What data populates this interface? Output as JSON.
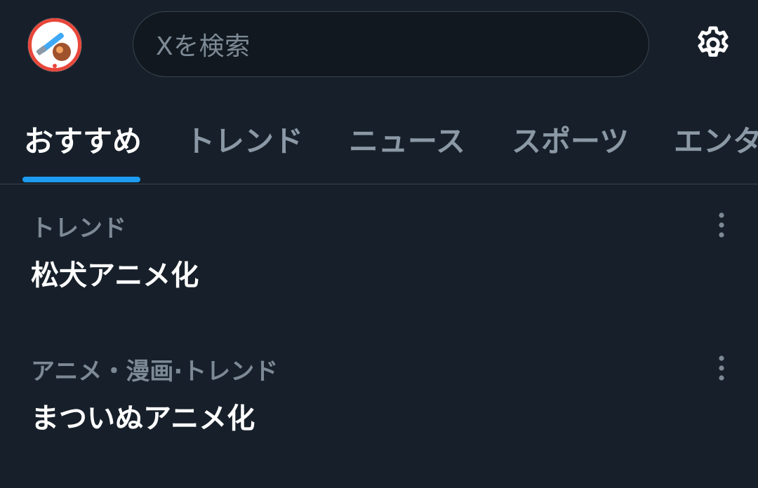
{
  "header": {
    "search": {
      "placeholder": "Xを検索"
    },
    "avatar_icon": "profile-avatar",
    "settings_icon": "gear-icon"
  },
  "tabs": [
    {
      "label": "おすすめ",
      "active": true
    },
    {
      "label": "トレンド",
      "active": false
    },
    {
      "label": "ニュース",
      "active": false
    },
    {
      "label": "スポーツ",
      "active": false
    },
    {
      "label": "エンタ",
      "active": false
    }
  ],
  "trends": [
    {
      "context": "トレンド",
      "title": "松犬アニメ化"
    },
    {
      "context": "アニメ・漫画·トレンド",
      "title": "まついぬアニメ化"
    }
  ],
  "colors": {
    "background": "#17202a",
    "accent": "#1d9bf0",
    "muted_text": "#7d8a96",
    "border": "#38444d"
  }
}
